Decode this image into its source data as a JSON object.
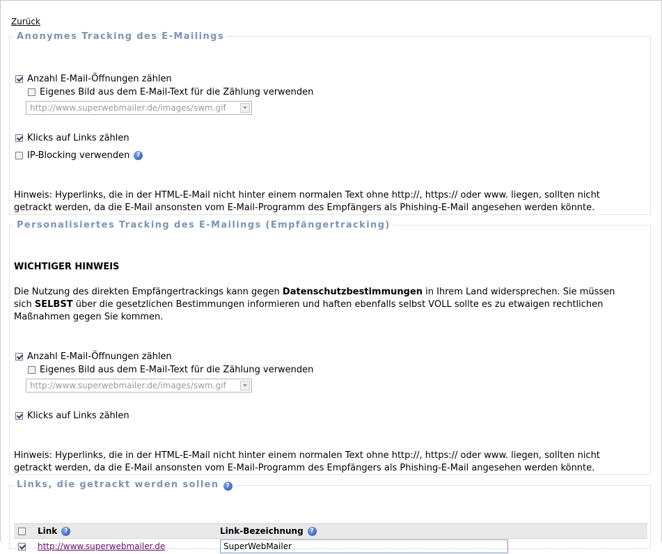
{
  "back_link": "Zurück",
  "anon": {
    "legend": "Anonymes Tracking des E-Mailings",
    "count_opens": {
      "label": "Anzahl E-Mail-Öffnungen zählen",
      "checked": true
    },
    "own_image": {
      "label": "Eigenes Bild aus dem E-Mail-Text für die Zählung verwenden",
      "checked": false
    },
    "image_select": "http://www.superwebmailer.de/images/swm.gif",
    "count_clicks": {
      "label": "Klicks auf Links zählen",
      "checked": true
    },
    "ip_blocking": {
      "label": "IP-Blocking verwenden",
      "checked": false
    },
    "hint": "Hinweis: Hyperlinks, die in der HTML-E-Mail nicht hinter einem normalen Text ohne http://, https:// oder www. liegen, sollten nicht getrackt werden, da die E-Mail ansonsten vom E-Mail-Programm des Empfängers als Phishing-E-Mail angesehen werden könnte."
  },
  "personal": {
    "legend": "Personalisiertes Tracking des E-Mailings (Empfängertracking)",
    "warning_title": "WICHTIGER HINWEIS",
    "warning_p1": "Die Nutzung des direkten Empfängertrackings kann gegen ",
    "warning_b1": "Datenschutzbestimmungen",
    "warning_p2": " in Ihrem Land widersprechen. Sie müssen sich ",
    "warning_b2": "SELBST",
    "warning_p3": " über die gesetzlichen Bestimmungen informieren und haften ebenfalls selbst VOLL sollte es zu etwaigen rechtlichen Maßnahmen gegen Sie kommen.",
    "count_opens": {
      "label": "Anzahl E-Mail-Öffnungen zählen",
      "checked": true
    },
    "own_image": {
      "label": "Eigenes Bild aus dem E-Mail-Text für die Zählung verwenden",
      "checked": false
    },
    "image_select": "http://www.superwebmailer.de/images/swm.gif",
    "count_clicks": {
      "label": "Klicks auf Links zählen",
      "checked": true
    },
    "hint": "Hinweis: Hyperlinks, die in der HTML-E-Mail nicht hinter einem normalen Text ohne http://, https:// oder www. liegen, sollten nicht getrackt werden, da die E-Mail ansonsten vom E-Mail-Programm des Empfängers als Phishing-E-Mail angesehen werden könnte."
  },
  "links": {
    "legend": "Links, die getrackt werden sollen",
    "col_link": "Link",
    "col_name": "Link-Bezeichnung",
    "rows": [
      {
        "url": "http://www.superwebmailer.de",
        "name": "SuperWebMailer",
        "checked": true
      }
    ]
  }
}
